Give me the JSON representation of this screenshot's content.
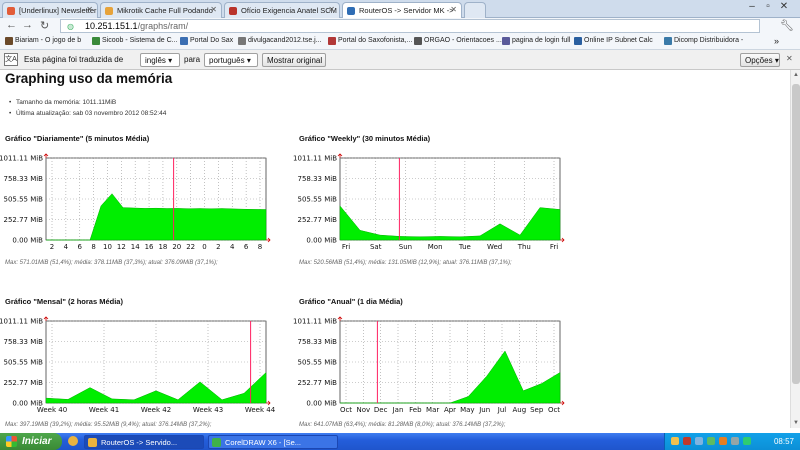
{
  "browser": {
    "tabs": [
      {
        "label": "[Underlinux] Newsletter 03/",
        "color": "#e25c38"
      },
      {
        "label": "Mikrotik Cache Full Podando",
        "color": "#e7a33a"
      },
      {
        "label": "Ofício Exigencia Anatel SCM",
        "color": "#b9332b"
      },
      {
        "label": "RouterOS -> Servidor MK ->",
        "color": "#2f6db5",
        "active": true
      }
    ],
    "url_host": "10.251.151.1",
    "url_path": "/graphs/ram/",
    "bookmarks": [
      {
        "label": "Biariam - O jogo de b",
        "color": "#6b4a2a"
      },
      {
        "label": "Sicoob - Sistema de C...",
        "color": "#3a8a3a"
      },
      {
        "label": "Portal Do Sax",
        "color": "#3b6fb3"
      },
      {
        "label": "divulgacand2012.tse.j...",
        "color": "#777777"
      },
      {
        "label": "Portal do Saxofonista,...",
        "color": "#b13838"
      },
      {
        "label": "ORGAO - Orientacoes ...",
        "color": "#555555"
      },
      {
        "label": "pagina de login full",
        "color": "#5a5a9a"
      },
      {
        "label": "Online IP Subnet Calc",
        "color": "#2a5fa0"
      },
      {
        "label": "Dicomp Distribuidora -",
        "color": "#3a7aa8"
      }
    ]
  },
  "translate_bar": {
    "text_before": "Esta página foi traduzida de",
    "from_lang": "inglês",
    "text_between": "para",
    "to_lang": "português",
    "show_original": "Mostrar original",
    "options": "Opções"
  },
  "page": {
    "title": "Graphing uso da memória",
    "info": [
      "Tamanho da memória: 1011.11MiB",
      "Última atualização: sab 03 novembro 2012 08:52:44"
    ]
  },
  "graphs": [
    {
      "title": "Gráfico \"Diariamente\" (5 minutos Média)",
      "stats": "Max: 571.01MiB (51,4%); média: 378.11MiB (37,3%); atual: 376.09MiB (37,1%);",
      "x_ticks": [
        "2",
        "4",
        "6",
        "8",
        "10",
        "12",
        "14",
        "16",
        "18",
        "20",
        "22",
        "0",
        "2",
        "4",
        "6",
        "8"
      ]
    },
    {
      "title": "Gráfico \"Weekly\" (30 minutos Média)",
      "stats": "Max: 520.56MiB (51,4%); média: 131.05MiB (12,9%); atual: 376.11MiB (37,1%);",
      "x_ticks": [
        "Fri",
        "Sat",
        "Sun",
        "Mon",
        "Tue",
        "Wed",
        "Thu",
        "Fri"
      ]
    },
    {
      "title": "Gráfico \"Mensal\" (2 horas Média)",
      "stats": "Max: 397.19MiB (39,2%); média: 95.52MiB (9,4%); atual: 376.14MiB (37,2%);",
      "x_ticks": [
        "Week 40",
        "Week 41",
        "Week 42",
        "Week 43",
        "Week 44"
      ]
    },
    {
      "title": "Gráfico \"Anual\" (1 dia Média)",
      "stats": "Max: 641.07MiB (63,4%); média: 81.28MiB (8,0%); atual: 376.14MiB (37,2%);",
      "x_ticks": [
        "Oct",
        "Nov",
        "Dec",
        "Jan",
        "Feb",
        "Mar",
        "Apr",
        "May",
        "Jun",
        "Jul",
        "Aug",
        "Sep",
        "Oct"
      ]
    }
  ],
  "y_axis_labels": [
    "1011.11 MiB",
    "758.33 MiB",
    "505.55 MiB",
    "252.77 MiB",
    "0.00 MiB"
  ],
  "chart_data": [
    {
      "type": "area",
      "title": "Gráfico \"Diariamente\" (5 minutos Média)",
      "x": [
        "2",
        "4",
        "6",
        "8",
        "9",
        "9.3",
        "9.7",
        "10",
        "11",
        "12",
        "14",
        "16",
        "18",
        "20",
        "22",
        "0",
        "2",
        "4",
        "6",
        "8",
        "9"
      ],
      "series": [
        {
          "values": [
            0,
            0,
            0,
            0,
            0,
            420,
            571,
            400,
            395,
            390,
            392,
            388,
            390,
            386,
            388,
            385,
            388,
            384,
            380,
            377,
            376
          ]
        }
      ],
      "ylim": [
        0,
        1011.11
      ],
      "color": "#00ee00"
    },
    {
      "type": "area",
      "title": "Gráfico \"Weekly\" (30 minutos Média)",
      "x": [
        "Fri",
        "Fri+6h",
        "Sat",
        "Sun",
        "Mon",
        "Tue",
        "Wed",
        "Thu",
        "Thu+12h",
        "Fri",
        "Fri+3h",
        "Fri+9h"
      ],
      "series": [
        {
          "values": [
            420,
            120,
            60,
            45,
            40,
            45,
            40,
            50,
            200,
            60,
            400,
            376
          ]
        }
      ],
      "ylim": [
        0,
        1011.11
      ],
      "color": "#00ee00"
    },
    {
      "type": "area",
      "title": "Gráfico \"Mensal\" (2 horas Média)",
      "x": [
        "Week 39.7",
        "Week 40",
        "Week 40.5",
        "Week 41",
        "Week 41.5",
        "Week 42",
        "Week 42.5",
        "Week 43",
        "Week 43.5",
        "Week 44",
        "Week 44.3"
      ],
      "series": [
        {
          "values": [
            60,
            45,
            190,
            50,
            40,
            150,
            40,
            260,
            40,
            120,
            376
          ]
        }
      ],
      "ylim": [
        0,
        1011.11
      ],
      "color": "#00ee00"
    },
    {
      "type": "area",
      "title": "Gráfico \"Anual\" (1 dia Média)",
      "x": [
        "Oct",
        "Nov",
        "Dec",
        "Jan",
        "Feb",
        "Mar",
        "Apr",
        "May",
        "Jun",
        "Jul",
        "Aug",
        "Sep",
        "Oct"
      ],
      "series": [
        {
          "values": [
            0,
            0,
            0,
            0,
            0,
            0,
            0,
            80,
            330,
            641,
            150,
            240,
            376
          ]
        }
      ],
      "ylim": [
        0,
        1011.11
      ],
      "color": "#00ee00"
    }
  ],
  "taskbar": {
    "start": "Iniciar",
    "items": [
      "RouterOS -> Servido...",
      "CorelDRAW X6 - [Se..."
    ],
    "clock": "08:57"
  }
}
